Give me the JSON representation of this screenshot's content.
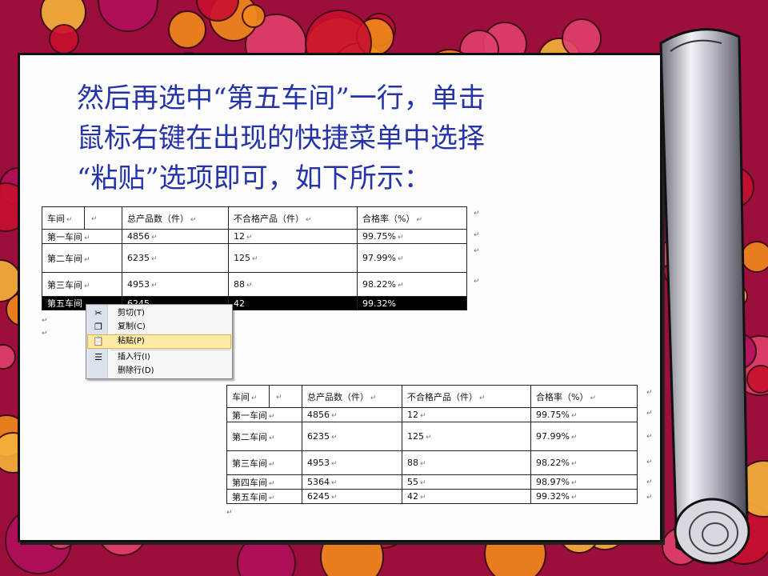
{
  "slide": {
    "title_lines": [
      "然后再选中“第五车间”一行，单击",
      "鼠标右键在出现的快捷菜单中选择",
      "“粘贴”选项即可，如下所示："
    ]
  },
  "paragraph_mark": "↵",
  "table1": {
    "header": [
      "车间",
      "总产品数（件）",
      "不合格产品（件）",
      "合格率（%）"
    ],
    "rows": [
      [
        "第一车间",
        "4856",
        "12",
        "99.75%"
      ],
      [
        "第二车间",
        "6235",
        "125",
        "97.99%"
      ],
      [
        "第三车间",
        "4953",
        "88",
        "98.22%"
      ],
      [
        "第五车间",
        "6245",
        "42",
        "99.32%"
      ]
    ],
    "selected_row": 3
  },
  "context_menu": {
    "items": [
      {
        "label": "剪切(T)",
        "icon": "scissors-icon"
      },
      {
        "label": "复制(C)",
        "icon": "copy-icon"
      },
      {
        "label": "粘贴(P)",
        "icon": "paste-icon",
        "highlighted": true
      },
      {
        "label": "插入行(I)",
        "icon": "insert-row-icon"
      },
      {
        "label": "删除行(D)",
        "icon": ""
      }
    ]
  },
  "table2": {
    "header": [
      "车间",
      "总产品数（件）",
      "不合格产品（件）",
      "合格率（%）"
    ],
    "rows": [
      [
        "第一车间",
        "4856",
        "12",
        "99.75%"
      ],
      [
        "第二车间",
        "6235",
        "125",
        "97.99%"
      ],
      [
        "第三车间",
        "4953",
        "88",
        "98.22%"
      ],
      [
        "第四车间",
        "5364",
        "55",
        "98.97%"
      ],
      [
        "第五车间",
        "6245",
        "42",
        "99.32%"
      ]
    ]
  },
  "colors": {
    "title_text": "#2533a8",
    "background_red": "#c8102e",
    "background_orange": "#f08a1c",
    "background_magenta": "#b0105a",
    "menu_highlight": "#fde9a8"
  }
}
